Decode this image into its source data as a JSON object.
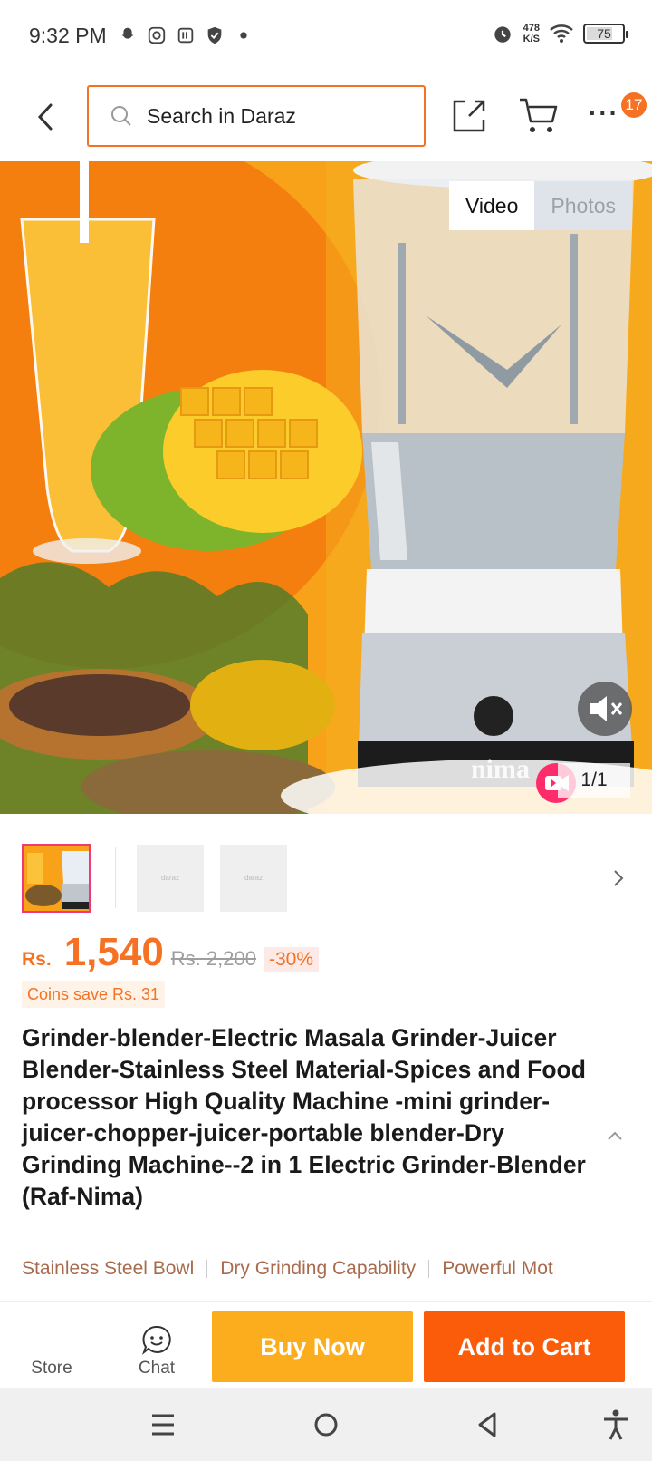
{
  "status_bar": {
    "time": "9:32 PM",
    "speed_value": "478",
    "speed_unit": "K/S",
    "battery": "75",
    "battery_level": 0.75,
    "icons": [
      "snapchat-icon",
      "instagram-icon",
      "app-icon",
      "shield-icon",
      "dot-icon",
      "alarm-icon",
      "wifi-icon",
      "battery-icon"
    ]
  },
  "header": {
    "search_placeholder": "Search in Daraz",
    "badge_count": "17"
  },
  "media": {
    "tab_video": "Video",
    "tab_photos": "Photos",
    "counter": "1/1",
    "brand_text": "nima"
  },
  "thumbnails": {
    "placeholder_1": "daraz",
    "placeholder_2": "daraz"
  },
  "price": {
    "currency": "Rs.",
    "current": "1,540",
    "original": "Rs. 2,200",
    "discount": "-30%",
    "coins": "Coins save Rs. 31"
  },
  "product": {
    "title": "Grinder-blender-Electric Masala Grinder-Juicer Blender-Stainless Steel Material-Spices and Food processor High Quality Machine -mini grinder-juicer-chopper-juicer-portable blender-Dry Grinding Machine--2 in 1 Electric Grinder-Blender (Raf-Nima)"
  },
  "highlights": [
    "Stainless Steel Bowl",
    "Dry Grinding Capability",
    "Powerful Mot"
  ],
  "bottom_bar": {
    "store_label": "Store",
    "chat_label": "Chat",
    "buy_now_label": "Buy Now",
    "add_to_cart_label": "Add to Cart"
  },
  "colors": {
    "accent": "#f57224",
    "buy_now": "#fcad1e",
    "add_to_cart": "#fa5c0a",
    "highlight_text": "#a86b4d"
  }
}
